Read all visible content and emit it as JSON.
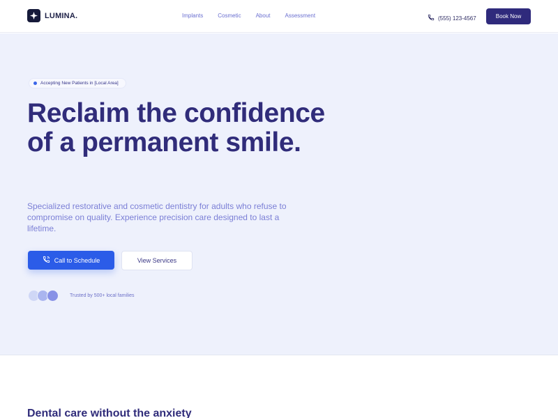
{
  "brand": {
    "name": "LUMINA."
  },
  "nav": {
    "items": [
      "Implants",
      "Cosmetic",
      "About",
      "Assessment"
    ]
  },
  "header": {
    "phone": "(555) 123-4567",
    "cta": "Book Now"
  },
  "hero": {
    "badge": "Accepting New Patients in [Local Area]",
    "headline_line1": "Reclaim the confidence",
    "headline_line2": "of a permanent smile.",
    "subtext": "Specialized restorative and cosmetic dentistry for adults who refuse to compromise on quality. Experience precision care designed to last a lifetime.",
    "primary_cta": "Call to Schedule",
    "secondary_cta": "View Services",
    "trust_text": "Trusted by 500+ local families"
  },
  "section": {
    "title": "Dental care without the anxiety"
  },
  "icons": [
    "logo-diamond-icon",
    "phone-icon",
    "phone-call-icon"
  ],
  "colors": {
    "brand_dark": "#2f2a7c",
    "accent_blue": "#2b5ce8",
    "hero_bg": "#eef1fc",
    "avatar_1": "#cfd7f6",
    "avatar_2": "#aab5ef",
    "avatar_3": "#8791e6"
  }
}
